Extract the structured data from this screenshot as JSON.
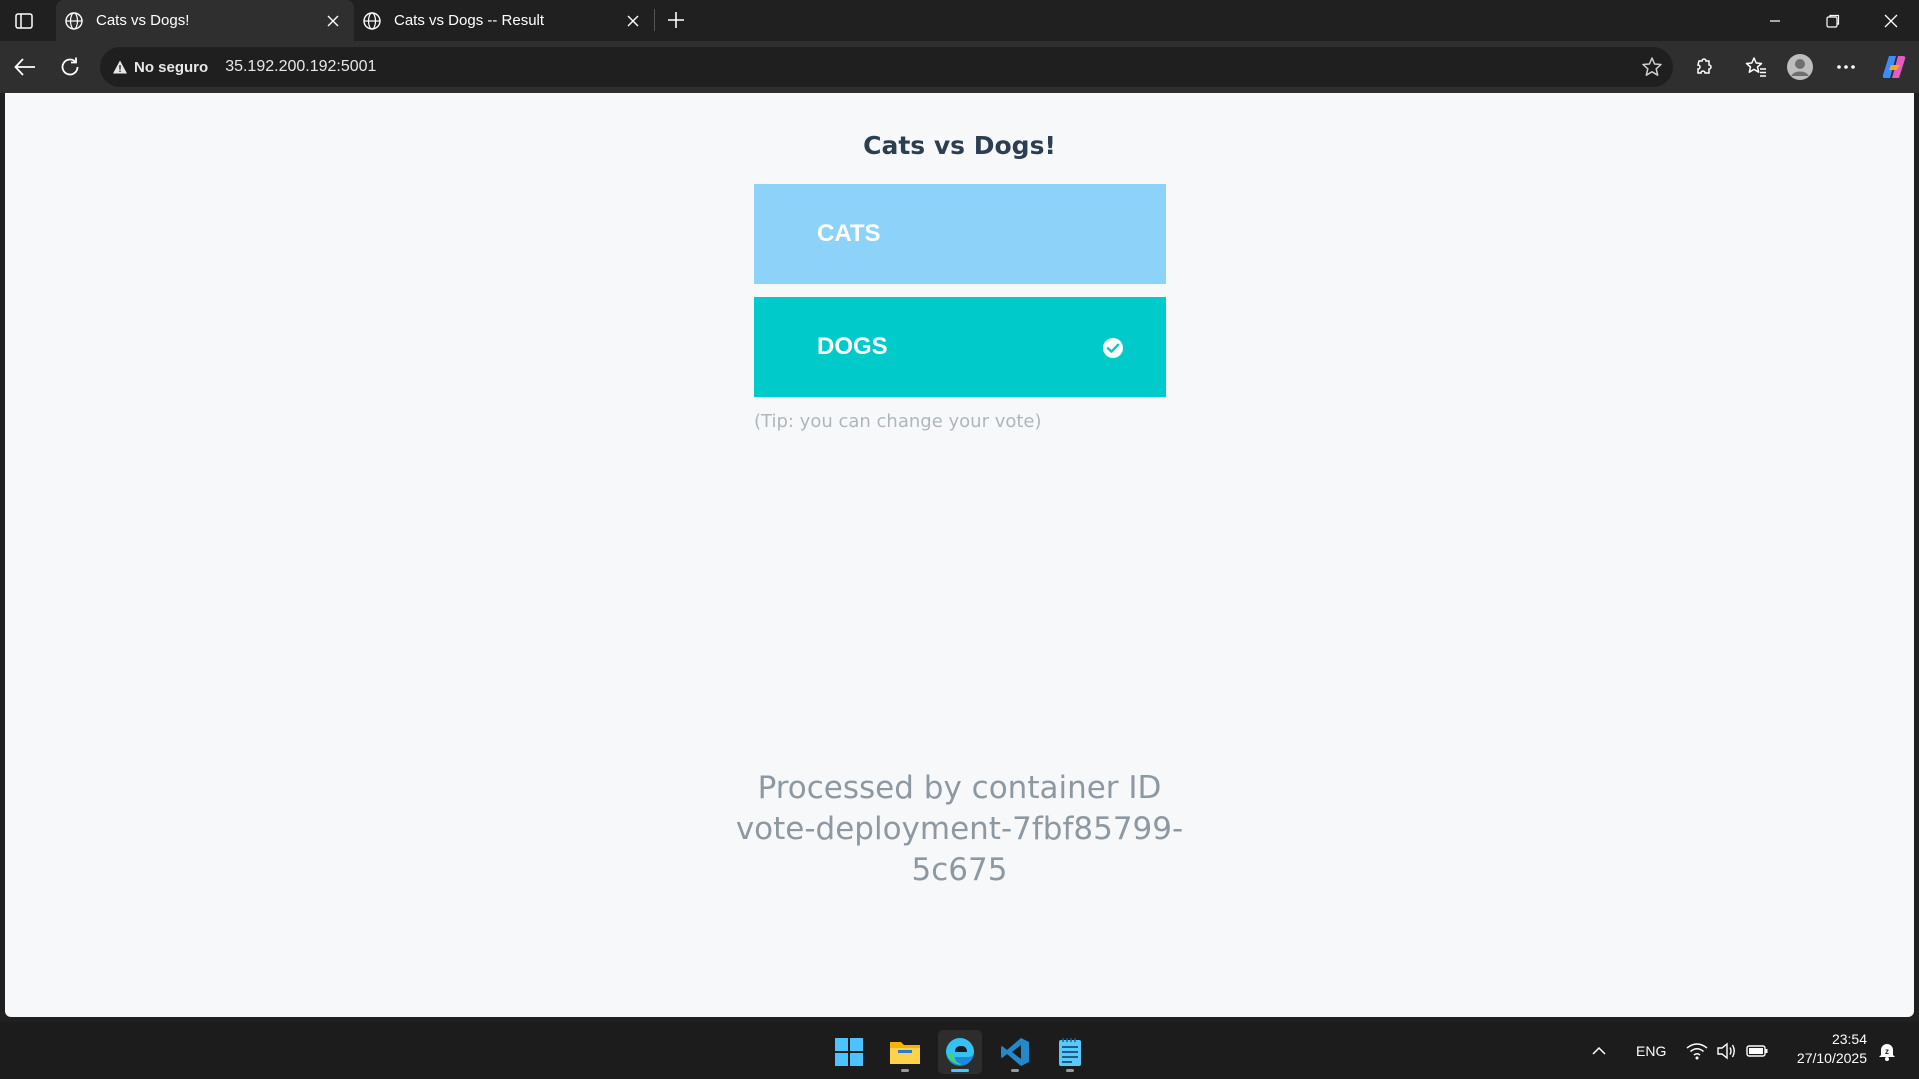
{
  "browser": {
    "tabs": [
      {
        "title": "Cats vs Dogs!",
        "active": true
      },
      {
        "title": "Cats vs Dogs -- Result",
        "active": false
      }
    ],
    "security_label": "No seguro",
    "url": "35.192.200.192:5001"
  },
  "page": {
    "title": "Cats vs Dogs!",
    "options": [
      {
        "label": "CATS",
        "selected": false,
        "color": "#8dd2f9"
      },
      {
        "label": "DOGS",
        "selected": true,
        "color": "#00cbca"
      }
    ],
    "tip": "(Tip: you can change your vote)",
    "processed_by_line1": "Processed by container ID",
    "processed_by_line2": "vote-deployment-7fbf85799-",
    "processed_by_line3": "5c675"
  },
  "taskbar": {
    "apps": [
      "windows-start-icon",
      "file-explorer-icon",
      "edge-icon",
      "vscode-icon",
      "notepad-icon"
    ],
    "language": "ENG",
    "time": "23:54",
    "date": "27/10/2025"
  }
}
